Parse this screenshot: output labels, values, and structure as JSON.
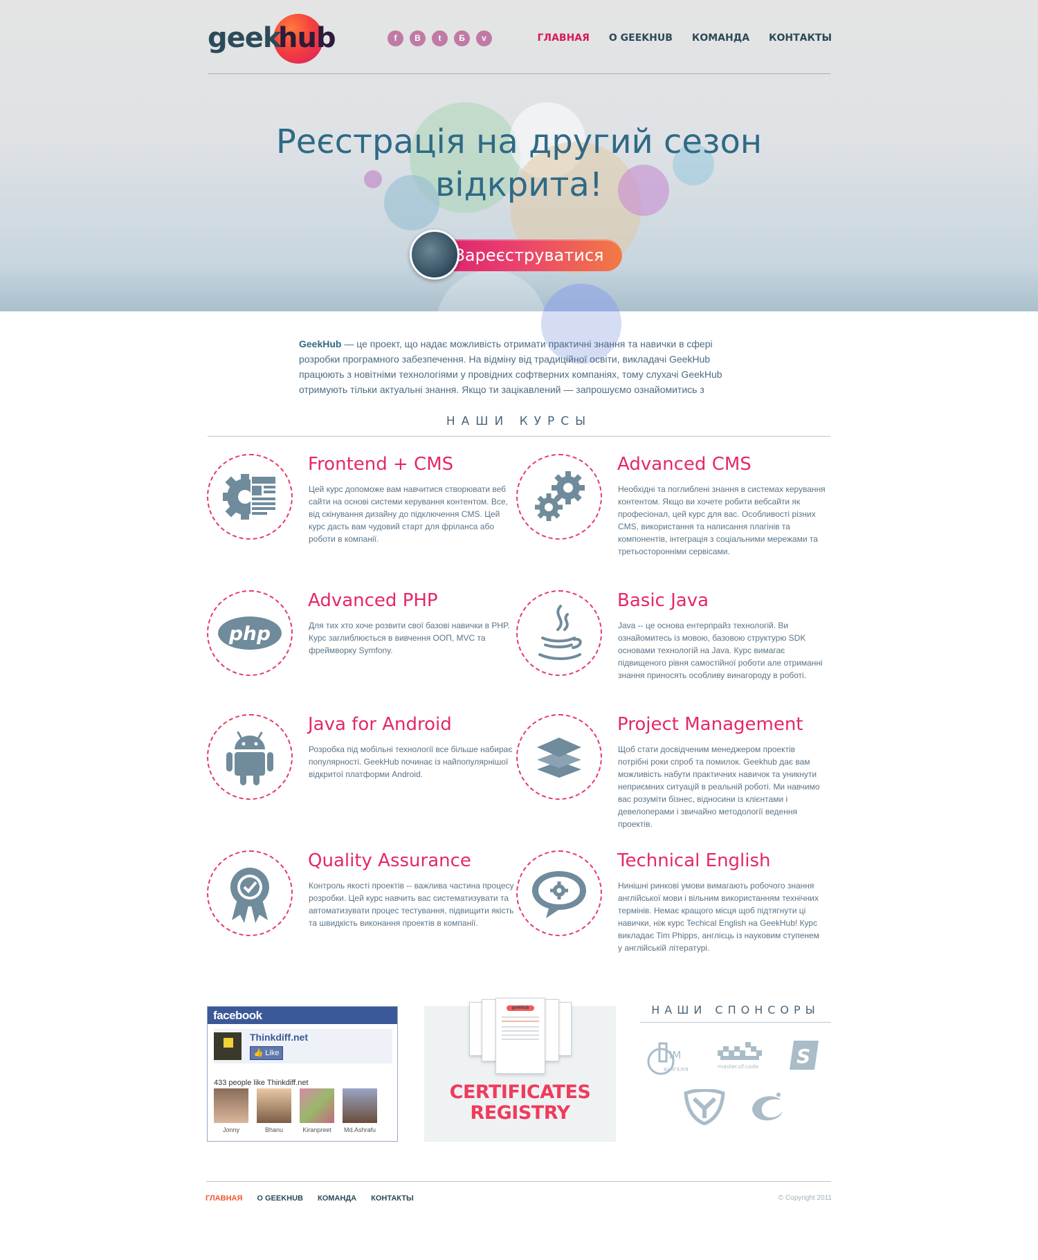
{
  "header": {
    "logo_geek": "geek",
    "logo_hub": "hub",
    "social": [
      {
        "icon": "facebook-icon",
        "glyph": "f"
      },
      {
        "icon": "vkontakte-icon",
        "glyph": "B"
      },
      {
        "icon": "twitter-icon",
        "glyph": "t"
      },
      {
        "icon": "livejournal-icon",
        "glyph": "Б"
      },
      {
        "icon": "vimeo-icon",
        "glyph": "v"
      }
    ],
    "nav": [
      "ГЛАВНАЯ",
      "О GEEKHUB",
      "КОМАНДА",
      "КОНТАКТЫ"
    ]
  },
  "hero": {
    "title_line1": "Реєстрація на другий сезон",
    "title_line2": "відкрита!",
    "register_label": "Зареєструватися"
  },
  "intro": {
    "brand": "GeekHub",
    "text": " — це проект, що надає можливість отримати практичні знання та навички в сфері розробки програмного забезпечення. На відміну від традиційної освіти, викладачі GeekHub працюють з новітніми технологіями у провідних софтверних компаніях, тому слухачі GeekHub отримують тільки актуальні знання. Якщо ти зацікавлений — запрошуємо ознайомитись з"
  },
  "courses_section": {
    "title": "НАШИ КУРСЫ",
    "items": [
      {
        "icon": "cms-gear-icon",
        "title": "Frontend + CMS",
        "text": "Цей курс допоможе вам навчитися створювати веб сайти на основі системи керування контентом. Все, від скінування дизайну до підключення CMS. Цей курс дасть вам чудовий старт для фріланса або роботи в компанії."
      },
      {
        "icon": "gears-icon",
        "title": "Advanced CMS",
        "text": "Необхідні та поглиблені знання в системах керування контентом. Якщо ви хочете робити вебсайти як професіонал, цей курс для вас. Особливості різних CMS, використання та написання плагінів та компонентів, інтеграція з соціальними мережами та третьосторонніми сервісами."
      },
      {
        "icon": "php-icon",
        "title": "Advanced PHP",
        "text": "Для тих хто хоче розвити свої базові навички в PHP. Курс заглиблюється в вивчення ООП, MVC та фреймворку Symfony."
      },
      {
        "icon": "java-icon",
        "title": "Basic Java",
        "text": "Java -- це основа ентерпрайз технологій. Ви ознайомитесь із мовою, базовою структурю SDK основами технологій на Java. Курс вимагає підвищеного рівня самостійної роботи але отриманні знання приносять особливу винагороду в роботі."
      },
      {
        "icon": "android-icon",
        "title": "Java for Android",
        "text": "Розробка під мобільні технології все більше набирає популярності. GeekHub починає із найпопулярнішої відкритої платформи Android."
      },
      {
        "icon": "layers-icon",
        "title": "Project Management",
        "text": "Щоб стати досвідченим менеджером проектів потрібні роки спроб та помилок. Geekhub дає вам можливість набути практичних навичок та уникнути неприємних ситуацій в реальній роботі. Ми навчимо вас розуміти бізнес, відносини із клієнтами і девелоперами і звичайно методології ведення проектів."
      },
      {
        "icon": "quality-badge-icon",
        "title": "Quality Assurance",
        "text": "Контроль якості проектів -- важлива частина процесу розробки. Цей курс навчить вас систематизувати та автоматизувати процес тестування, підвищити якість та швидкість виконання проектів в компанії."
      },
      {
        "icon": "speech-gear-icon",
        "title": "Technical English",
        "text": "Нинішні ринкові умови вимагають робочого знання англійської мови і вільним використанням технічних термінів. Немає кращого місця щоб підтягнути ці навички, ніж курс Techical English на GeekHub! Курс викладає Tim Phipps, англієць із науковим ступенем у англійській літературі."
      }
    ]
  },
  "facebook": {
    "header": "facebook",
    "page_name": "Thinkdiff.net",
    "thumb_label": "Thinkdiff.net",
    "like_label": "Like",
    "count_text": "433 people like Thinkdiff.net",
    "people": [
      "Jonny",
      "Bhanu",
      "Kiranpreet",
      "Md.Ashrafu"
    ]
  },
  "certificates": {
    "line1": "CERTIFICATES",
    "line2": "REGISTRY",
    "doc_logo": "geekhub"
  },
  "sponsors": {
    "title": "НАШИ СПОНСОРЫ",
    "logos": [
      {
        "icon": "im-vangelia-logo",
        "text": "ВАНГЕЛІЯ"
      },
      {
        "icon": "master-of-code-logo",
        "text": "master.of.code"
      },
      {
        "icon": "s-logo",
        "text": ""
      },
      {
        "icon": "y-shield-logo",
        "text": ""
      },
      {
        "icon": "swirl-logo",
        "text": ""
      }
    ]
  },
  "footer": {
    "nav": [
      "ГЛАВНАЯ",
      "О GEEKHUB",
      "КОМАНДА",
      "КОНТАКТЫ"
    ],
    "copyright": "© Copyright 2011"
  },
  "colors": {
    "accent": "#e5276a",
    "brand_dark": "#2d4a59",
    "title_blue": "#2f6a86",
    "facebook": "#3b5998"
  }
}
